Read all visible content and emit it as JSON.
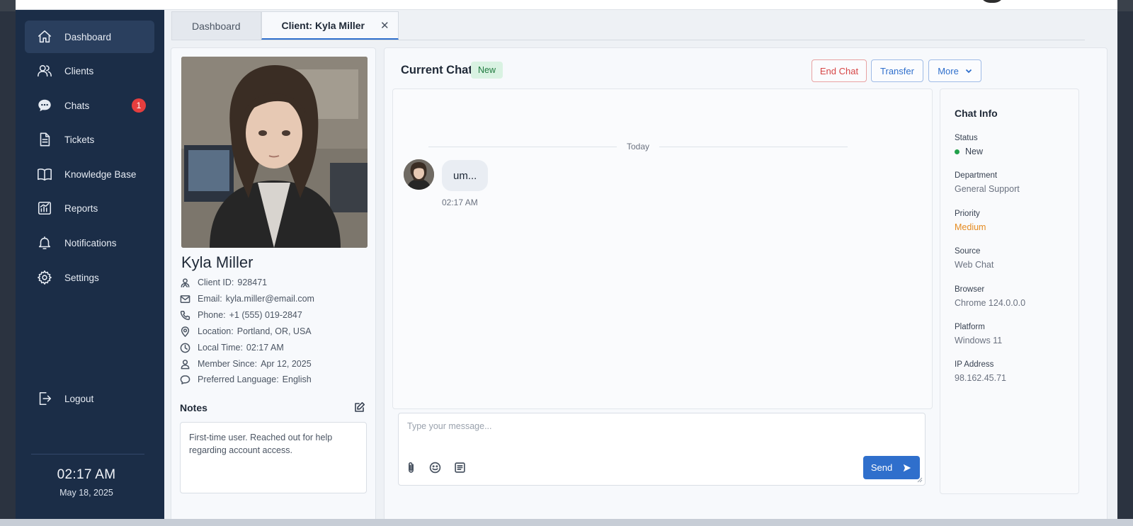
{
  "sidebar": {
    "items": [
      {
        "label": "Dashboard",
        "icon": "home-icon"
      },
      {
        "label": "Clients",
        "icon": "users-icon"
      },
      {
        "label": "Chats",
        "icon": "chat-bubble-icon",
        "badge": "1"
      },
      {
        "label": "Tickets",
        "icon": "document-icon"
      },
      {
        "label": "Knowledge Base",
        "icon": "book-icon"
      },
      {
        "label": "Reports",
        "icon": "chart-icon"
      },
      {
        "label": "Notifications",
        "icon": "bell-icon"
      },
      {
        "label": "Settings",
        "icon": "gear-icon"
      }
    ],
    "logout_label": "Logout",
    "clock_time": "02:17 AM",
    "clock_date": "May 18, 2025"
  },
  "tabs": [
    {
      "label": "Dashboard"
    },
    {
      "label": "Client: Kyla Miller",
      "close": "✕"
    }
  ],
  "client": {
    "name": "Kyla Miller",
    "fields": [
      {
        "label": "Client ID:",
        "value": "928471",
        "icon": "id-icon"
      },
      {
        "label": "Email:",
        "value": "kyla.miller@email.com",
        "icon": "mail-icon"
      },
      {
        "label": "Phone:",
        "value": "+1 (555) 019-2847",
        "icon": "phone-icon"
      },
      {
        "label": "Location:",
        "value": "Portland, OR, USA",
        "icon": "location-pin-icon"
      },
      {
        "label": "Local Time:",
        "value": "02:17 AM",
        "icon": "clock-icon"
      },
      {
        "label": "Member Since:",
        "value": "Apr 12, 2025",
        "icon": "user-icon"
      },
      {
        "label": "Preferred Language:",
        "value": "English",
        "icon": "speech-icon"
      }
    ],
    "notes_title": "Notes",
    "notes_text": "First-time user. Reached out for help regarding account access."
  },
  "chat": {
    "title": "Current Chat",
    "status": "New",
    "end_label": "End Chat",
    "transfer_label": "Transfer",
    "more_label": "More",
    "day_separator": "Today",
    "messages": [
      {
        "text": "um...",
        "time": "02:17 AM"
      }
    ],
    "composer_placeholder": "Type your message...",
    "send_label": "Send"
  },
  "chat_info": {
    "title": "Chat Info",
    "fields": [
      {
        "label": "Status",
        "value": "New"
      },
      {
        "label": "Department",
        "value": "General Support"
      },
      {
        "label": "Priority",
        "value": "Medium"
      },
      {
        "label": "Source",
        "value": "Web Chat"
      },
      {
        "label": "Browser",
        "value": "Chrome 124.0.0.0"
      },
      {
        "label": "Platform",
        "value": "Windows 11"
      },
      {
        "label": "IP Address",
        "value": "98.162.45.71"
      }
    ]
  },
  "colors": {
    "sidebar_bg": "#1b2d47",
    "accent": "#2f6fcc",
    "danger": "#d64545",
    "success": "#22a04b",
    "warning": "#e58a1f"
  }
}
